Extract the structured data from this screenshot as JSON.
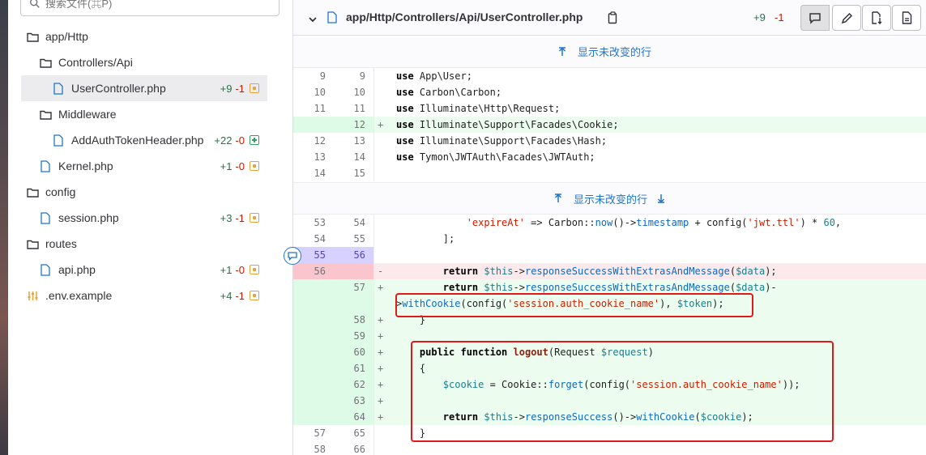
{
  "sidebar": {
    "search_placeholder": "搜索文件(⌘P)",
    "items": [
      {
        "label": "app/Http",
        "type": "folder"
      },
      {
        "label": "Controllers/Api",
        "type": "folder"
      },
      {
        "label": "UserController.php",
        "type": "file",
        "add": "+9",
        "del": "-1",
        "status": "modified",
        "active": true
      },
      {
        "label": "Middleware",
        "type": "folder"
      },
      {
        "label": "AddAuthTokenHeader.php",
        "type": "file",
        "add": "+22",
        "del": "-0",
        "status": "added"
      },
      {
        "label": "Kernel.php",
        "type": "file",
        "add": "+1",
        "del": "-0",
        "status": "modified"
      },
      {
        "label": "config",
        "type": "folder"
      },
      {
        "label": "session.php",
        "type": "file",
        "add": "+3",
        "del": "-1",
        "status": "modified"
      },
      {
        "label": "routes",
        "type": "folder"
      },
      {
        "label": "api.php",
        "type": "file",
        "add": "+1",
        "del": "-0",
        "status": "modified"
      },
      {
        "label": ".env.example",
        "type": "config-file",
        "add": "+4",
        "del": "-1",
        "status": "modified"
      }
    ]
  },
  "diff": {
    "file_path": "app/Http/Controllers/Api/UserController.php",
    "additions": "+9",
    "deletions": "-1",
    "expand_label": "显示未改变的行"
  },
  "colors": {
    "accent": "#1f75cb",
    "added": "#217645",
    "removed": "#c91c00",
    "highlight_box": "#e0191b"
  }
}
